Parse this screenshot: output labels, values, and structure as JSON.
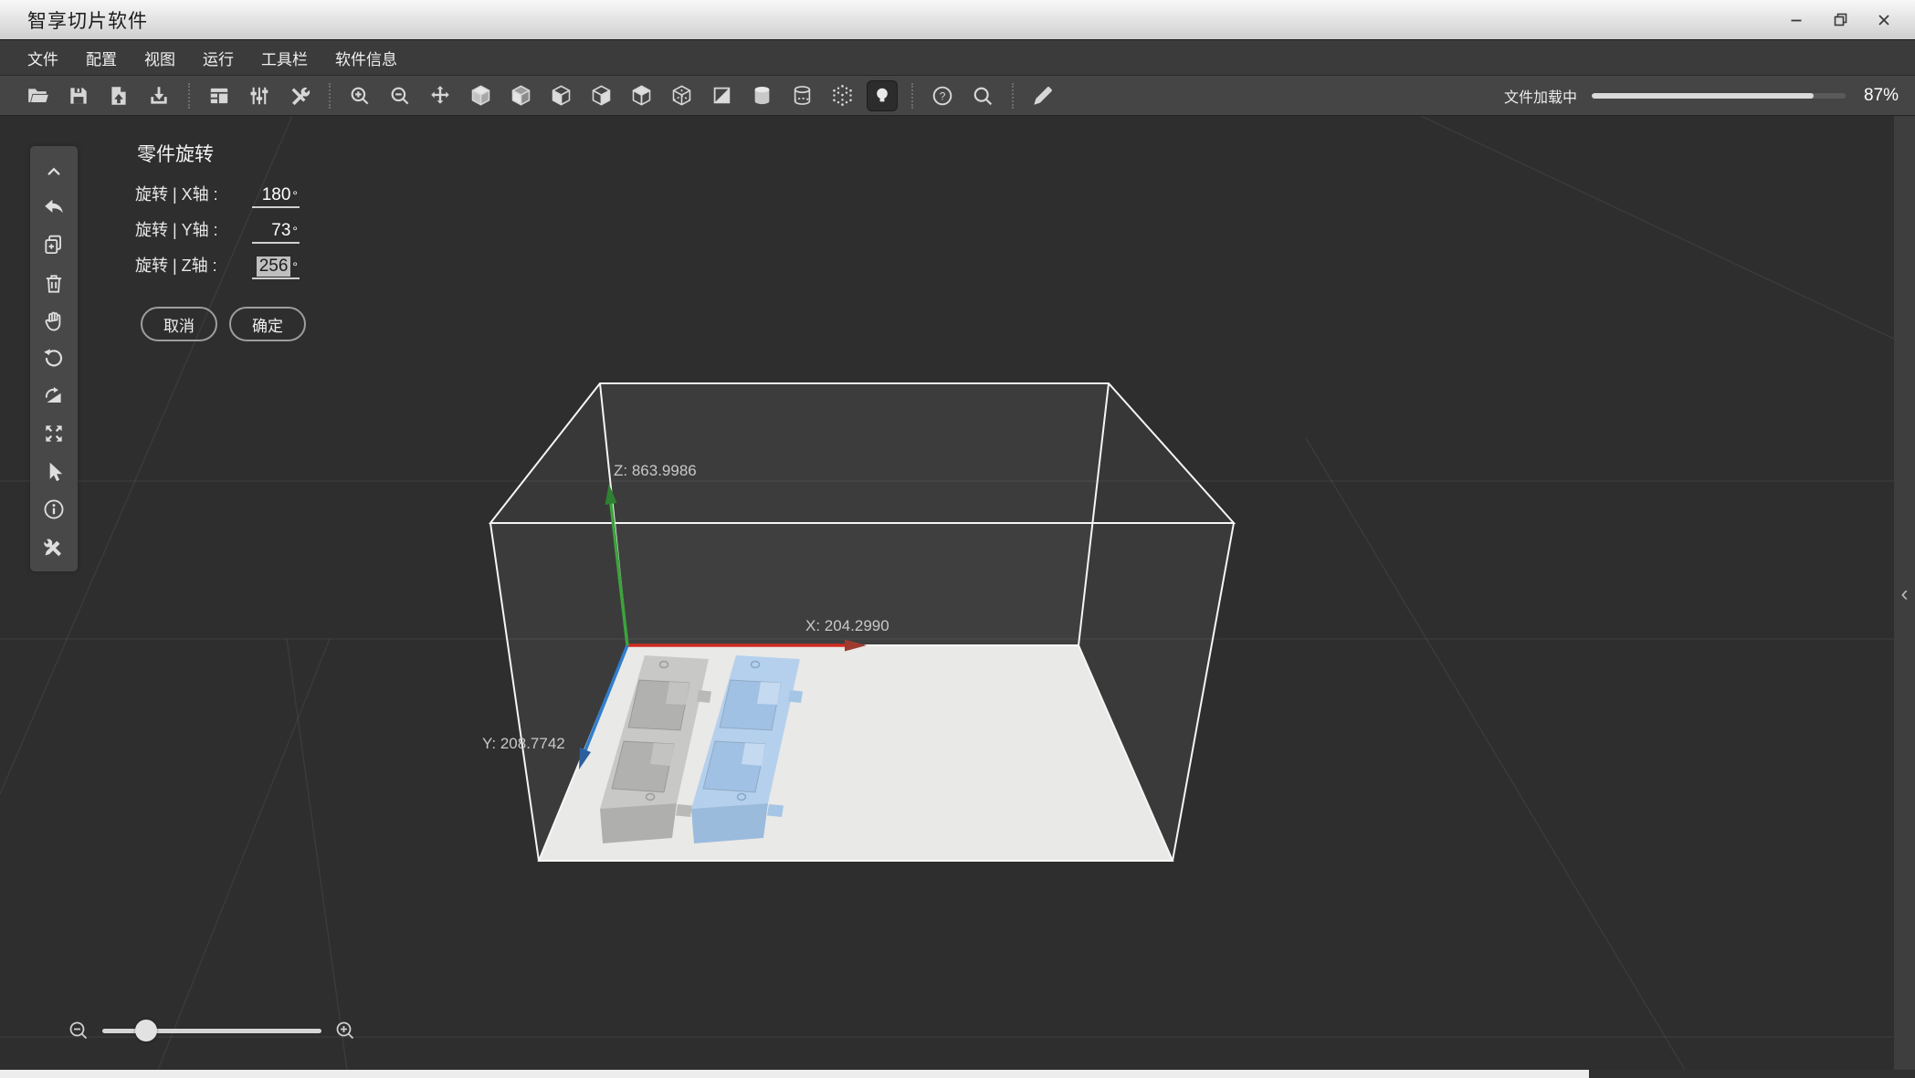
{
  "window": {
    "title": "智享切片软件",
    "controls": {
      "minimize": "minimize",
      "restore": "restore",
      "close": "close"
    }
  },
  "menu": {
    "items": [
      "文件",
      "配置",
      "视图",
      "运行",
      "工具栏",
      "软件信息"
    ]
  },
  "toolbar": {
    "icons": [
      "open-file",
      "save-file",
      "export-file",
      "import-file",
      "machine-settings",
      "parameter-settings",
      "tools",
      "zoom-in",
      "zoom-out",
      "move-view",
      "view-iso",
      "view-left",
      "view-front",
      "view-right",
      "view-top",
      "view-wireframe",
      "view-section",
      "cylinder-solid",
      "cylinder-wireframe",
      "point-cloud",
      "light-toggle",
      "help",
      "search",
      "annotate"
    ],
    "active_icon": "light-toggle",
    "help_glyph": "?",
    "loading": {
      "label": "文件加载中",
      "percent_text": "87%",
      "percent": 87.5
    }
  },
  "left_toolbar": {
    "icons": [
      "collapse-up",
      "undo",
      "duplicate",
      "delete",
      "pan",
      "rotate-view",
      "lay-flat",
      "fit-view",
      "select",
      "info",
      "repair"
    ]
  },
  "rotation_panel": {
    "title": "零件旋转",
    "rows": [
      {
        "label": "旋转 | X轴 :",
        "value": "180",
        "unit": "°",
        "selected": false
      },
      {
        "label": "旋转 | Y轴 :",
        "value": "73",
        "unit": "°",
        "selected": false
      },
      {
        "label": "旋转 | Z轴 :",
        "value": "256",
        "unit": "°",
        "selected": true
      }
    ],
    "cancel": "取消",
    "confirm": "确定"
  },
  "scene": {
    "axis_labels": {
      "x": "X: 204.2990",
      "y": "Y: 208.7742",
      "z": "Z: 863.9986"
    },
    "axis_colors": {
      "x": "#d02b20",
      "y": "#2e7ece",
      "z": "#3da23d"
    },
    "plate_color": "#e9e9e7",
    "models": [
      {
        "name": "mold-part-gray",
        "color": "#c7c7c5"
      },
      {
        "name": "mold-part-blue",
        "color": "#b4d0ed"
      }
    ]
  },
  "zoom_control": {
    "percent": 20
  },
  "right_panel": {
    "chevron": "‹"
  },
  "colors": {
    "selection": "#bfbfbf",
    "progress_fill": "#dadada",
    "toolbar_bg": "#454545"
  }
}
